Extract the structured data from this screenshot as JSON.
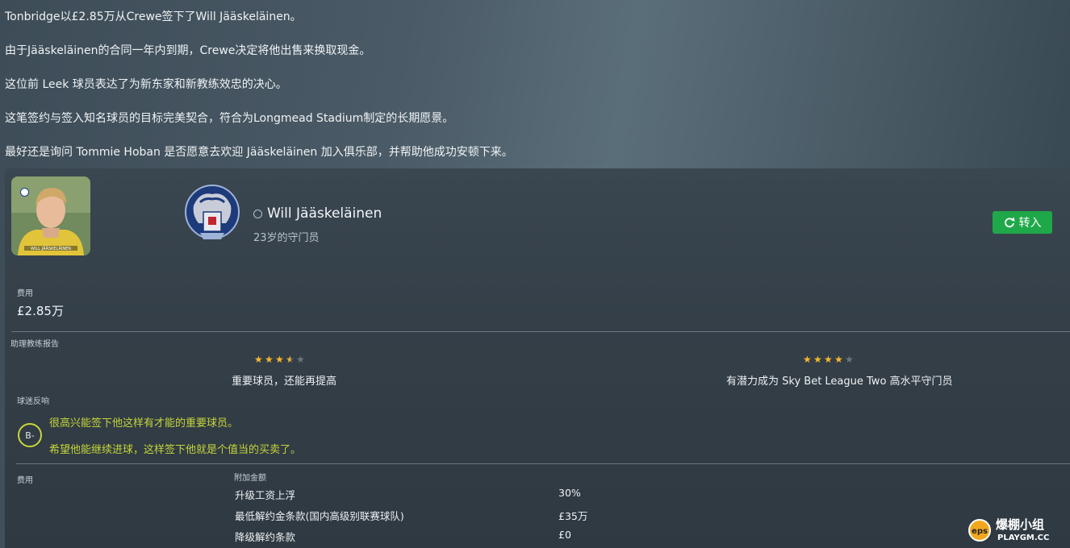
{
  "news": {
    "line1": "Tonbridge以£2.85万从Crewe签下了Will Jääskeläinen。",
    "line2": "由于Jääskeläinen的合同一年内到期，Crewe决定将他出售来换取现金。",
    "line3": "这位前 Leek 球员表达了为新东家和新教练效忠的决心。",
    "line4": "这笔签约与签入知名球员的目标完美契合，符合为Longmead Stadium制定的长期愿景。",
    "line5": "最好还是询问 Tommie Hoban 是否愿意去欢迎 Jääskeläinen 加入俱乐部，并帮助他成功安顿下来。"
  },
  "player": {
    "name": "Will Jääskeläinen",
    "subtitle": "23岁的守门员",
    "shirt_text": "WILL JÄÄSKELÄINEN"
  },
  "transfer_button": {
    "label": "转入",
    "color": "#1fa84a"
  },
  "fee": {
    "label": "费用",
    "value": "£2.85万"
  },
  "assistant_report": {
    "title": "助理教练报告",
    "current": {
      "stars": 3.5,
      "text": "重要球员，还能再提高"
    },
    "potential": {
      "stars": 4,
      "text": "有潜力成为 Sky Bet League Two 高水平守门员"
    }
  },
  "fan_reaction": {
    "title": "球迷反响",
    "grade": "B-",
    "line1": "很高兴能签下他这样有才能的重要球员。",
    "line2": "希望他能继续进球，这样签下他就是个值当的买卖了。"
  },
  "fee_details": {
    "label": "费用",
    "addon_title": "附加金额",
    "rows": [
      {
        "label": "升级工资上浮",
        "value": "30%"
      },
      {
        "label": "最低解约金条款(国内高级别联赛球队)",
        "value": "£35万"
      },
      {
        "label": "降级解约条款",
        "value": "£0"
      }
    ]
  },
  "watermark": {
    "title": "爆棚小组",
    "site": "PLAYGM.CC",
    "badge": "eps"
  },
  "colors": {
    "star": "#f5b82e",
    "star_empty": "#6c7780",
    "fan_text": "#c6d43a",
    "accent_green": "#1fa84a"
  }
}
